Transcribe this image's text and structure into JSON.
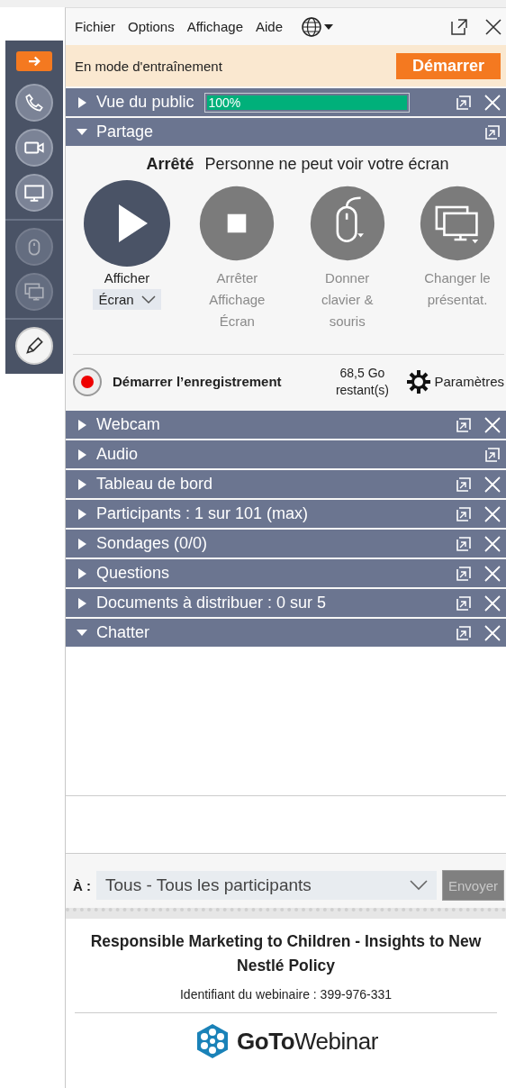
{
  "menu": [
    "Fichier",
    "Options",
    "Affichage",
    "Aide"
  ],
  "toolbar": [
    {
      "selected": false,
      "disabled": false
    },
    {
      "selected": false,
      "disabled": false
    },
    {
      "selected": false,
      "disabled": false
    },
    {
      "selected": false,
      "disabled": false
    },
    {
      "selected": false,
      "disabled": true
    },
    {
      "selected": false,
      "disabled": true
    },
    {
      "selected": true,
      "disabled": false
    }
  ],
  "banner": {
    "text": "En mode d'entraînement",
    "button": "Démarrer"
  },
  "panes": [
    {
      "kind": "progress",
      "label": "Vue du public",
      "expanded": false,
      "closable": true,
      "level": 1,
      "reading": "100%"
    },
    {
      "kind": "share",
      "label": "Partage",
      "expanded": true,
      "closable": false
    },
    {
      "kind": "plain",
      "label": "Webcam",
      "expanded": false,
      "closable": true
    },
    {
      "kind": "plain",
      "label": "Audio",
      "expanded": false,
      "closable": false
    },
    {
      "kind": "plain",
      "label": "Tableau de bord",
      "expanded": false,
      "closable": true
    },
    {
      "kind": "plain",
      "label": "Participants :  1 sur 101 (max)",
      "expanded": false,
      "closable": true
    },
    {
      "kind": "plain",
      "label": "Sondages (0/0)",
      "expanded": false,
      "closable": true
    },
    {
      "kind": "plain",
      "label": "Questions",
      "expanded": false,
      "closable": true
    },
    {
      "kind": "plain",
      "label": "Documents à distribuer : 0 sur 5",
      "expanded": false,
      "closable": true
    },
    {
      "kind": "chat",
      "label": "Chatter",
      "expanded": true,
      "closable": true
    }
  ],
  "share": {
    "status": "Arrêté",
    "message": "Personne ne peut voir votre écran",
    "actions": [
      {
        "label": "Afficher",
        "disabled": false,
        "dropdown": "Écran"
      },
      {
        "label": "Arrêter Affichage Écran",
        "disabled": true
      },
      {
        "label": "Donner clavier & souris",
        "disabled": true
      },
      {
        "label": "Changer le présentat.",
        "disabled": true
      }
    ],
    "record": {
      "label": "Démarrer l’enregistrement",
      "space": "68,5 Go restant(s)",
      "settings": "Paramètres"
    }
  },
  "chat": {
    "to_label": "À :",
    "recipient": "Tous - Tous les participants",
    "send": "Envoyer",
    "send_disabled": true
  },
  "footer": {
    "title": "Responsible Marketing to Children - Insights to New Nestlé Policy",
    "webinar_id": "Identifiant du webinaire : 399-976-331",
    "logo": "**GoTo**Webinar"
  }
}
